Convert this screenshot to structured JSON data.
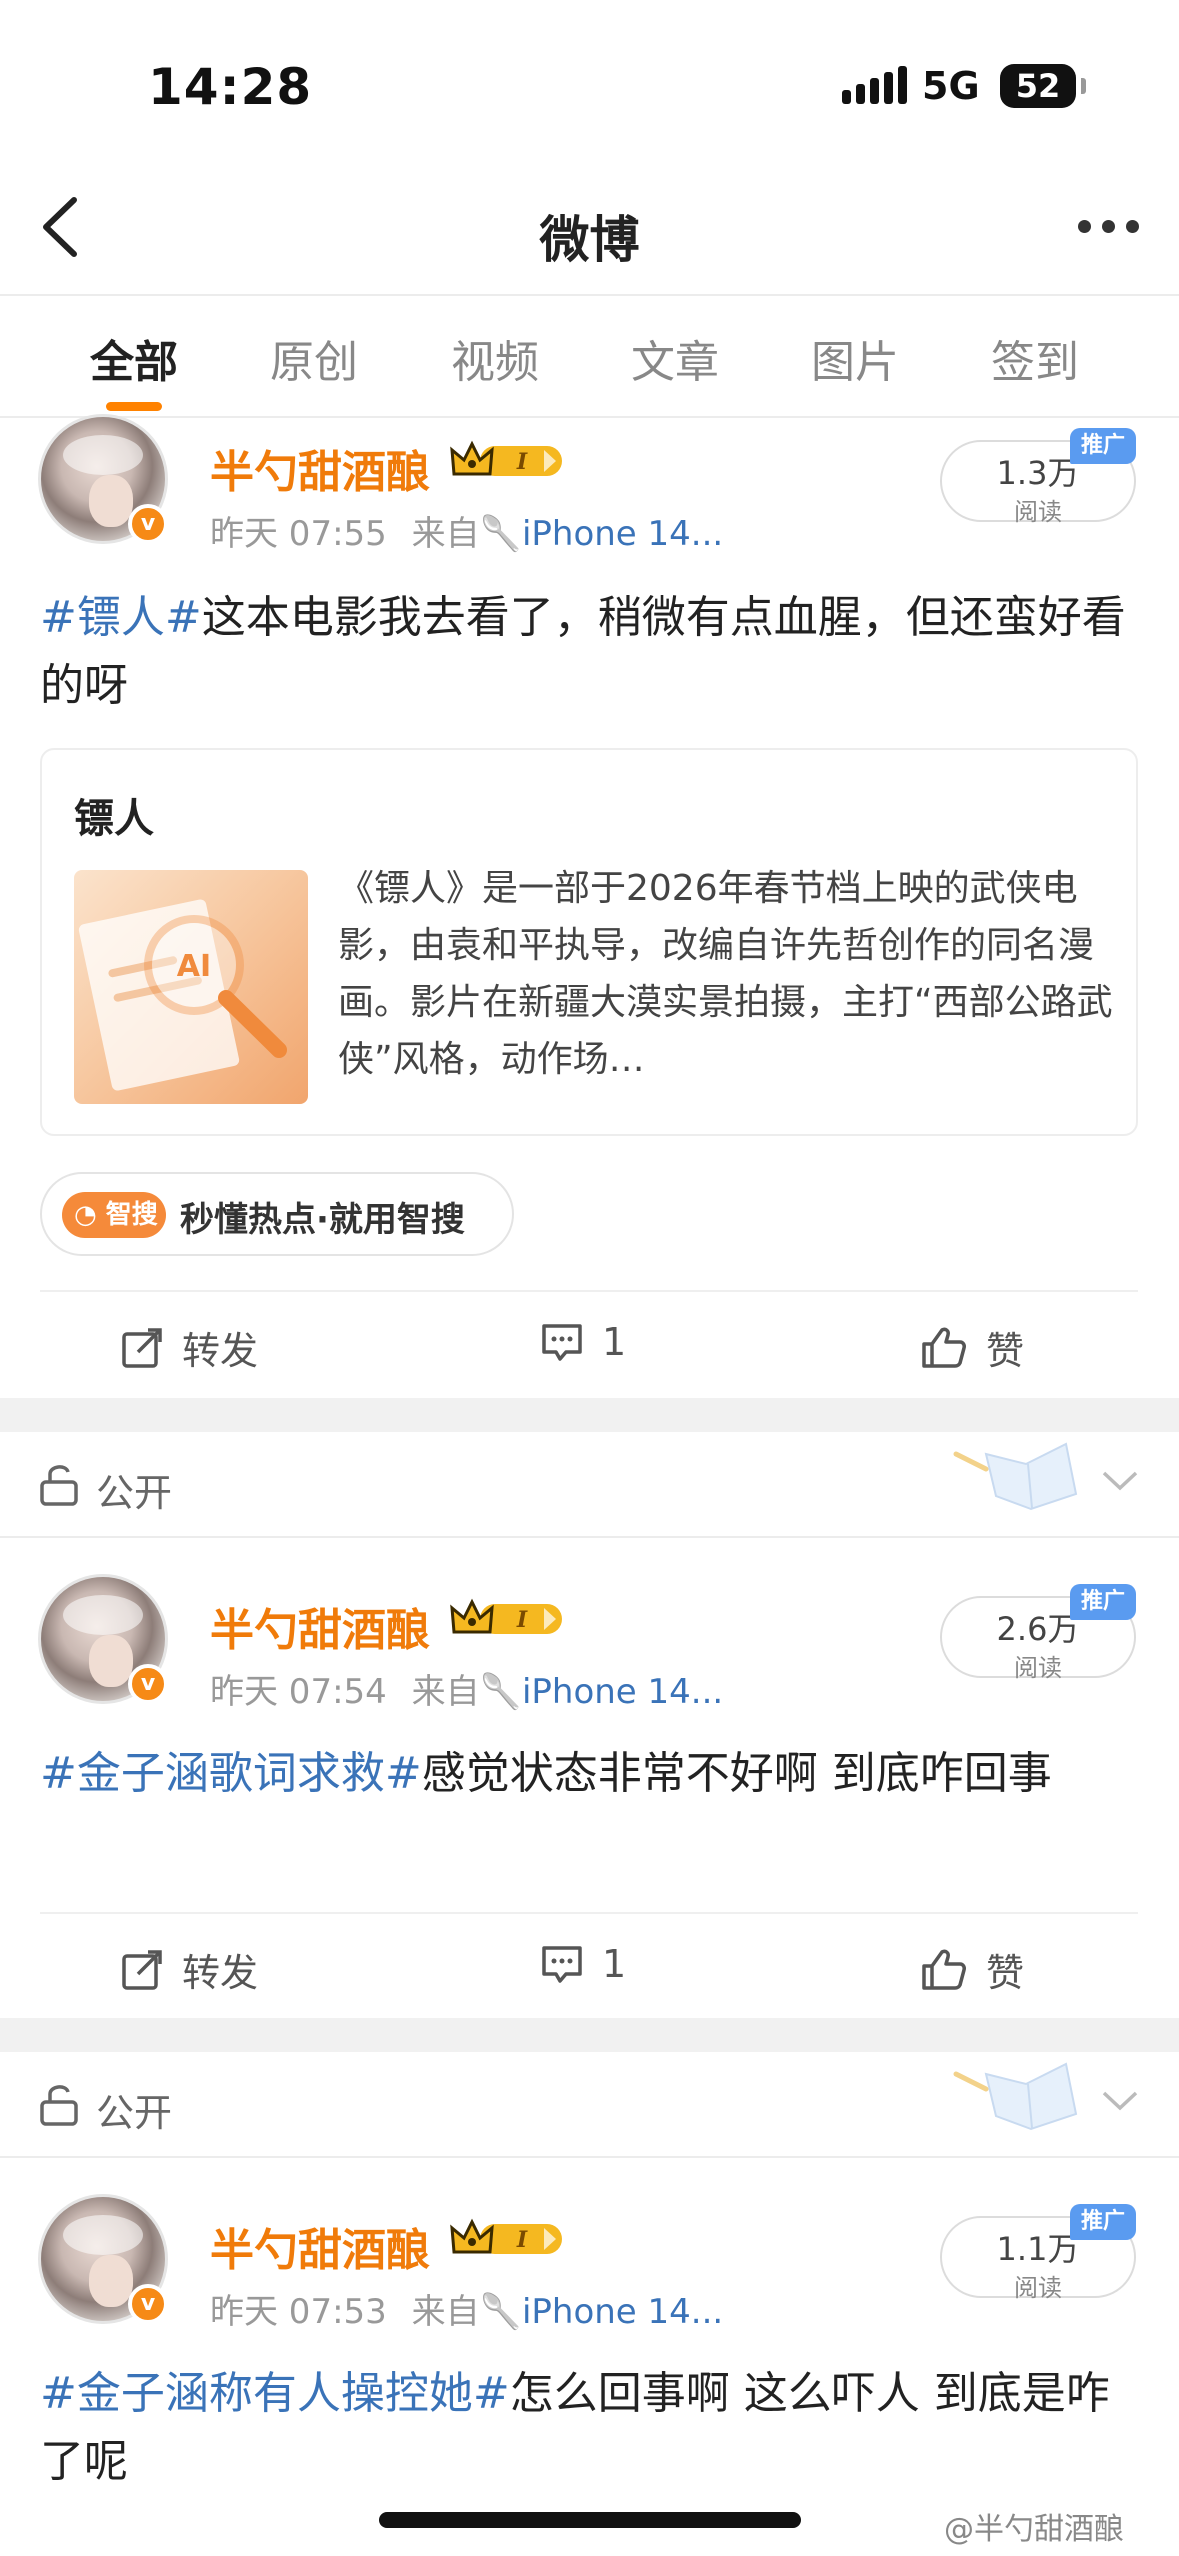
{
  "status": {
    "time": "14:28",
    "network": "5G",
    "battery": "52"
  },
  "nav": {
    "title": "微博"
  },
  "tabs": [
    "全部",
    "原创",
    "视频",
    "文章",
    "图片",
    "签到"
  ],
  "posts": [
    {
      "name": "半勺甜酒酿",
      "time": "昨天 07:55",
      "from": "来自",
      "source": "iPhone 14...",
      "reads": "1.3万",
      "reads_label": "阅读",
      "promo": "推广",
      "topic": "#镖人#",
      "text": "这本电影我去看了，稍微有点血腥，但还蛮好看的呀",
      "card": {
        "title": "镖人",
        "thumb_label": "AI",
        "desc": "《镖人》是一部于2026年春节档上映的武侠电影，由袁和平执导，改编自许先哲创作的同名漫画。影片在新疆大漠实景拍摄，主打“西部公路武侠”风格，动作场…"
      },
      "zhisou": {
        "tag": "智搜",
        "text": "秒懂热点·就用智搜"
      },
      "repost": "转发",
      "comments": "1",
      "like": "赞"
    },
    {
      "name": "半勺甜酒酿",
      "time": "昨天 07:54",
      "from": "来自",
      "source": "iPhone 14...",
      "reads": "2.6万",
      "reads_label": "阅读",
      "promo": "推广",
      "topic": "#金子涵歌词求救#",
      "text": "感觉状态非常不好啊 到底咋回事",
      "repost": "转发",
      "comments": "1",
      "like": "赞"
    },
    {
      "name": "半勺甜酒酿",
      "time": "昨天 07:53",
      "from": "来自",
      "source": "iPhone 14...",
      "reads": "1.1万",
      "reads_label": "阅读",
      "promo": "推广",
      "topic": "#金子涵称有人操控她#",
      "text": "怎么回事啊 这么吓人 到底是咋了呢"
    }
  ],
  "visibility": "公开",
  "watermark": "@半勺甜酒酿",
  "colors": {
    "accent": "#ff8200",
    "name": "#f07b0a",
    "link": "#3a73b8",
    "promo": "#5a9bf0"
  },
  "icons": [
    "chevron-left-icon",
    "more-icon",
    "lock-icon",
    "repost-icon",
    "comment-icon",
    "like-icon",
    "verified-icon",
    "crown-icon",
    "spoon-icon",
    "chevron-down-icon"
  ]
}
